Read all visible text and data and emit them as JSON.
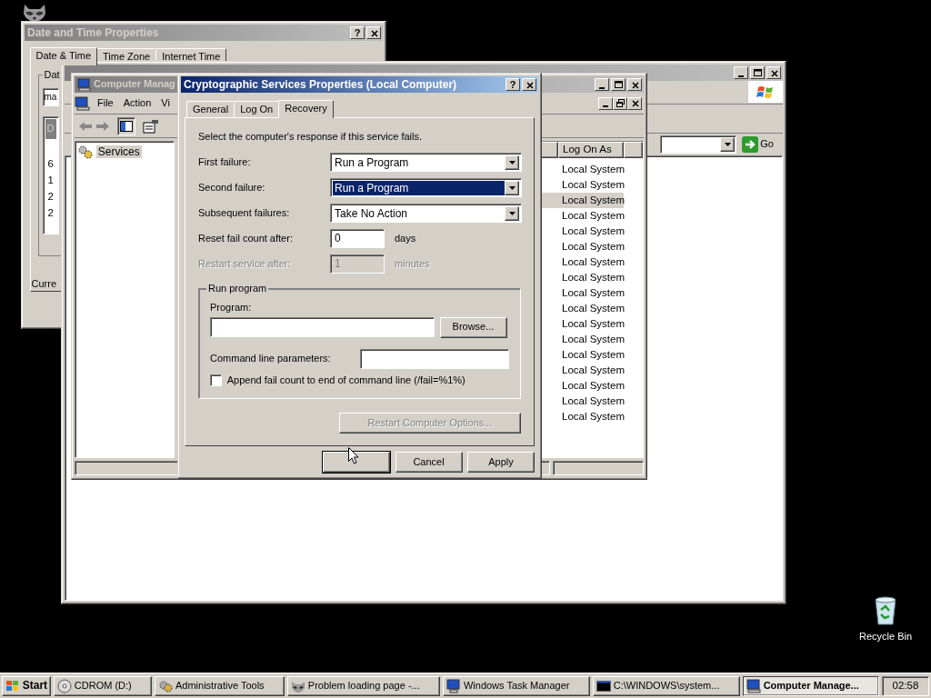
{
  "date_time_window": {
    "title": "Date and Time Properties",
    "help_button": "?",
    "tabs": [
      {
        "label": "Date & Time",
        "selected": true
      },
      {
        "label": "Time Zone",
        "selected": false
      },
      {
        "label": "Internet Time",
        "selected": false
      }
    ],
    "group_label": "Dat",
    "field_value": "ma",
    "calendar_header": "D",
    "calendar_days": [
      "6",
      "1",
      "2",
      "2"
    ],
    "current_label": "Curre"
  },
  "explorer_window": {
    "go_button": "Go"
  },
  "computer_management": {
    "title": "Computer Manag",
    "menu": [
      "File",
      "Action",
      "Vi"
    ],
    "tree": [
      {
        "label": "Services",
        "selected": true
      }
    ],
    "columns": [
      "Log On As"
    ],
    "rows": [
      {
        "log_on_as": "Local System",
        "selected": false
      },
      {
        "log_on_as": "Local System",
        "selected": false
      },
      {
        "log_on_as": "Local System",
        "selected": true
      },
      {
        "log_on_as": "Local System",
        "selected": false
      },
      {
        "log_on_as": "Local System",
        "selected": false
      },
      {
        "log_on_as": "Local System",
        "selected": false
      },
      {
        "log_on_as": "Local System",
        "selected": false
      },
      {
        "log_on_as": "Local System",
        "selected": false
      },
      {
        "log_on_as": "Local System",
        "selected": false
      },
      {
        "log_on_as": "Local System",
        "selected": false
      },
      {
        "log_on_as": "Local System",
        "selected": false
      },
      {
        "log_on_as": "Local System",
        "selected": false
      },
      {
        "log_on_as": "Local System",
        "selected": false
      },
      {
        "log_on_as": "Local System",
        "selected": false
      },
      {
        "log_on_as": "Local System",
        "selected": false
      },
      {
        "log_on_as": "Local System",
        "selected": false
      },
      {
        "log_on_as": "Local System",
        "selected": false
      }
    ]
  },
  "dialog": {
    "title": "Cryptographic Services Properties (Local Computer)",
    "help_button": "?",
    "tabs": [
      {
        "label": "General",
        "selected": false
      },
      {
        "label": "Log On",
        "selected": false
      },
      {
        "label": "Recovery",
        "selected": true
      }
    ],
    "intro": "Select the computer's response if this service fails.",
    "failures": [
      {
        "label": "First failure:",
        "value": "Run a Program",
        "focused": false
      },
      {
        "label": "Second failure:",
        "value": "Run a Program",
        "focused": true
      },
      {
        "label": "Subsequent failures:",
        "value": "Take No Action",
        "focused": false
      }
    ],
    "counts": [
      {
        "label": "Reset fail count after:",
        "value": "0",
        "unit": "days",
        "disabled": false
      },
      {
        "label": "Restart service after:",
        "value": "1",
        "unit": "minutes",
        "disabled": true
      }
    ],
    "run_program": {
      "legend": "Run program",
      "program_label": "Program:",
      "browse": "Browse...",
      "params_label": "Command line parameters:",
      "append": {
        "label": "Append fail count to end of command line (/fail=%1%)",
        "checked": false
      }
    },
    "restart_options": {
      "label": "Restart Computer Options...",
      "disabled": true
    },
    "buttons": [
      {
        "kind": "default"
      },
      {
        "kind": "normal",
        "label": "Cancel"
      },
      {
        "kind": "normal",
        "label": "Apply"
      }
    ]
  },
  "desktop_icons": [
    {
      "label": "Recycle Bin"
    }
  ],
  "taskbar": {
    "start": "Start",
    "tasks": [
      {
        "label": "CDROM (D:)",
        "active": false
      },
      {
        "label": "Administrative Tools",
        "active": false
      },
      {
        "label": "Problem loading page -...",
        "active": false
      },
      {
        "label": "Windows Task Manager",
        "active": false
      },
      {
        "label": "C:\\WINDOWS\\system...",
        "active": false
      },
      {
        "label": "Computer Manage...",
        "active": true
      }
    ],
    "clock": "02:58"
  }
}
